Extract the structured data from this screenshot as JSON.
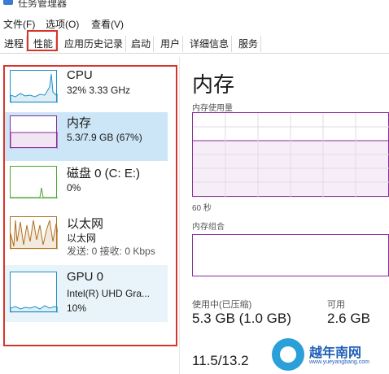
{
  "window": {
    "title": "任务管理器"
  },
  "menu": [
    "文件(F)",
    "选项(O)",
    "查看(V)"
  ],
  "tabs": [
    "进程",
    "性能",
    "应用历史记录",
    "启动",
    "用户",
    "详细信息",
    "服务"
  ],
  "active_tab": "性能",
  "resources": [
    {
      "name": "CPU",
      "line1": "32% 3.33 GHz",
      "color": "#1e90c8"
    },
    {
      "name": "内存",
      "line1": "5.3/7.9 GB (67%)",
      "color": "#8a2a9b"
    },
    {
      "name": "磁盘 0 (C: E:)",
      "line1": "0%",
      "color": "#4aa832"
    },
    {
      "name": "以太网",
      "line1": "以太网",
      "line2": "发送: 0 接收: 0 Kbps",
      "color": "#b0701f"
    },
    {
      "name": "GPU 0",
      "line1": "Intel(R) UHD Gra...",
      "line2": "10%",
      "color": "#1e90c8"
    }
  ],
  "detail": {
    "title": "内存",
    "usage_label": "内存使用量",
    "time_label": "60 秒",
    "composition_label": "内存组合",
    "in_use_label": "使用中(已压缩)",
    "in_use_value": "5.3 GB (1.0 GB)",
    "available_label": "可用",
    "available_value": "2.6 GB",
    "committed_value": "11.5/13.2"
  },
  "watermark": {
    "text": "越年南网",
    "url": "www.yueyangbang.com"
  },
  "colors": {
    "highlight": "#d9342b",
    "memory": "#8a2a9b",
    "selected": "#cce6f7"
  }
}
